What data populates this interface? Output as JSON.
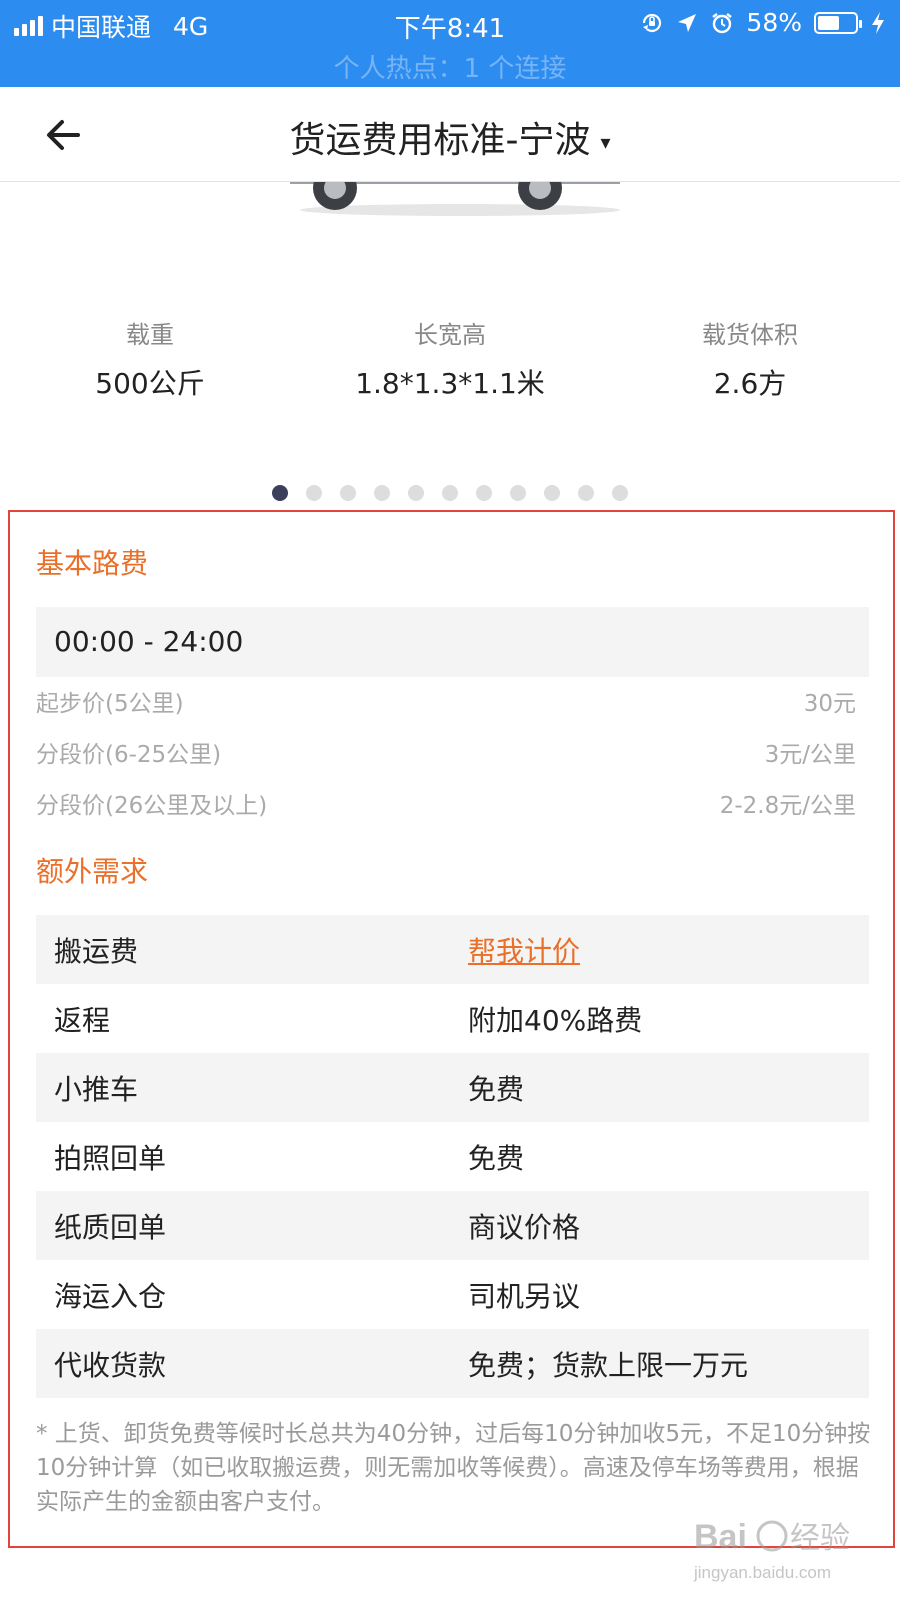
{
  "status_bar": {
    "carrier": "中国联通",
    "network": "4G",
    "time": "下午8:41",
    "battery_pct": "58%",
    "battery_level": 0.58,
    "hotspot_text": "个人热点：1 个连接",
    "icons": [
      "lock-rotation-icon",
      "location-arrow-icon",
      "alarm-icon",
      "charging-icon"
    ]
  },
  "header": {
    "title": "货运费用标准-宁波",
    "caret": "▾"
  },
  "vehicle_specs": [
    {
      "label": "载重",
      "value": "500公斤"
    },
    {
      "label": "长宽高",
      "value": "1.8*1.3*1.1米"
    },
    {
      "label": "载货体积",
      "value": "2.6方"
    }
  ],
  "carousel": {
    "count": 11,
    "active_index": 0
  },
  "base_fee": {
    "title": "基本路费",
    "time_range": "00:00 - 24:00",
    "rows": [
      {
        "name": "起步价(5公里)",
        "price": "30元"
      },
      {
        "name": "分段价(6-25公里)",
        "price": "3元/公里"
      },
      {
        "name": "分段价(26公里及以上)",
        "price": "2-2.8元/公里"
      }
    ]
  },
  "extra": {
    "title": "额外需求",
    "rows": [
      {
        "name": "搬运费",
        "value": "帮我计价",
        "link": true
      },
      {
        "name": "返程",
        "value": "附加40%路费"
      },
      {
        "name": "小推车",
        "value": "免费"
      },
      {
        "name": "拍照回单",
        "value": "免费"
      },
      {
        "name": "纸质回单",
        "value": "商议价格"
      },
      {
        "name": "海运入仓",
        "value": "司机另议"
      },
      {
        "name": "代收货款",
        "value": "免费；货款上限一万元"
      }
    ]
  },
  "note": "* 上货、卸货免费等候时长总共为40分钟，过后每10分钟加收5元，不足10分钟按10分钟计算（如已收取搬运费，则无需加收等候费）。高速及停车场等费用，根据实际产生的金额由客户支付。",
  "watermark": {
    "brand": "Baidu经验",
    "url": "jingyan.baidu.com"
  }
}
